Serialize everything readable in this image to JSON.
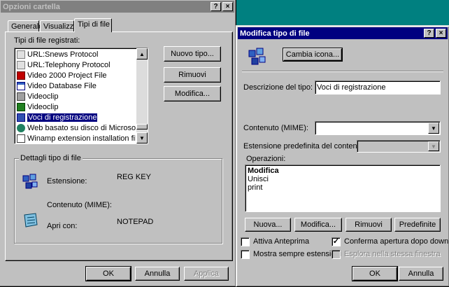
{
  "left_window": {
    "title": "Opzioni cartella",
    "title_buttons": [
      "?",
      "×"
    ],
    "tabs": [
      "Generale",
      "Visualizza",
      "Tipi di file"
    ],
    "list_label": "Tipi di file registrati:",
    "file_types": [
      {
        "label": "URL:Snews Protocol",
        "icon": "url-icon"
      },
      {
        "label": "URL:Telephony Protocol",
        "icon": "url-icon"
      },
      {
        "label": "Video 2000 Project File",
        "icon": "video-project-icon"
      },
      {
        "label": "Video Database File",
        "icon": "database-icon"
      },
      {
        "label": "Videoclip",
        "icon": "videoclip-icon"
      },
      {
        "label": "Videoclip",
        "icon": "videoclip-icon"
      },
      {
        "label": "Voci di registrazione",
        "icon": "registry-icon",
        "selected": true
      },
      {
        "label": "Web basato su disco di Microsoft ...",
        "icon": "web-icon"
      },
      {
        "label": "Winamp extension installation file",
        "icon": "winamp-icon"
      }
    ],
    "buttons": {
      "new": "Nuovo tipo...",
      "remove": "Rimuovi",
      "edit": "Modifica..."
    },
    "details": {
      "group_label": "Dettagli tipo di file",
      "extension_label": "Estensione:",
      "extension_value": "REG KEY",
      "content_label": "Contenuto (MIME):",
      "content_value": "",
      "open_with_label": "Apri con:",
      "open_with_value": "NOTEPAD"
    },
    "footer": {
      "ok": "OK",
      "cancel": "Annulla",
      "apply": "Applica"
    }
  },
  "right_window": {
    "title": "Modifica tipo di file",
    "title_buttons": [
      "?",
      "×"
    ],
    "change_icon_button": "Cambia icona...",
    "description_label": "Descrizione del tipo:",
    "description_value": "Voci di registrazione",
    "content_label": "Contenuto (MIME):",
    "content_value": "",
    "default_ext_label": "Estensione predefinita del contenuto:",
    "default_ext_value": "",
    "operations_label": "Operazioni:",
    "operations": [
      {
        "label": "Modifica",
        "bold": true
      },
      {
        "label": "Unisci",
        "bold": false
      },
      {
        "label": "print",
        "bold": false
      }
    ],
    "op_buttons": {
      "new": "Nuova...",
      "edit": "Modifica...",
      "remove": "Rimuovi",
      "default": "Predefinite"
    },
    "checkboxes": {
      "quick_view": {
        "label": "Attiva Anteprima",
        "checked": false
      },
      "confirm_open": {
        "label": "Conferma apertura dopo download",
        "checked": true
      },
      "always_show_ext": {
        "label": "Mostra sempre estensioni",
        "checked": false
      },
      "browse_same_window": {
        "label": "Esplora nella stessa finestra",
        "checked": false
      }
    },
    "footer": {
      "ok": "OK",
      "cancel": "Annulla"
    }
  },
  "colors": {
    "desktop": "#008080",
    "active_title": "#000080",
    "inactive_title": "#808080",
    "face": "#c0c0c0"
  }
}
